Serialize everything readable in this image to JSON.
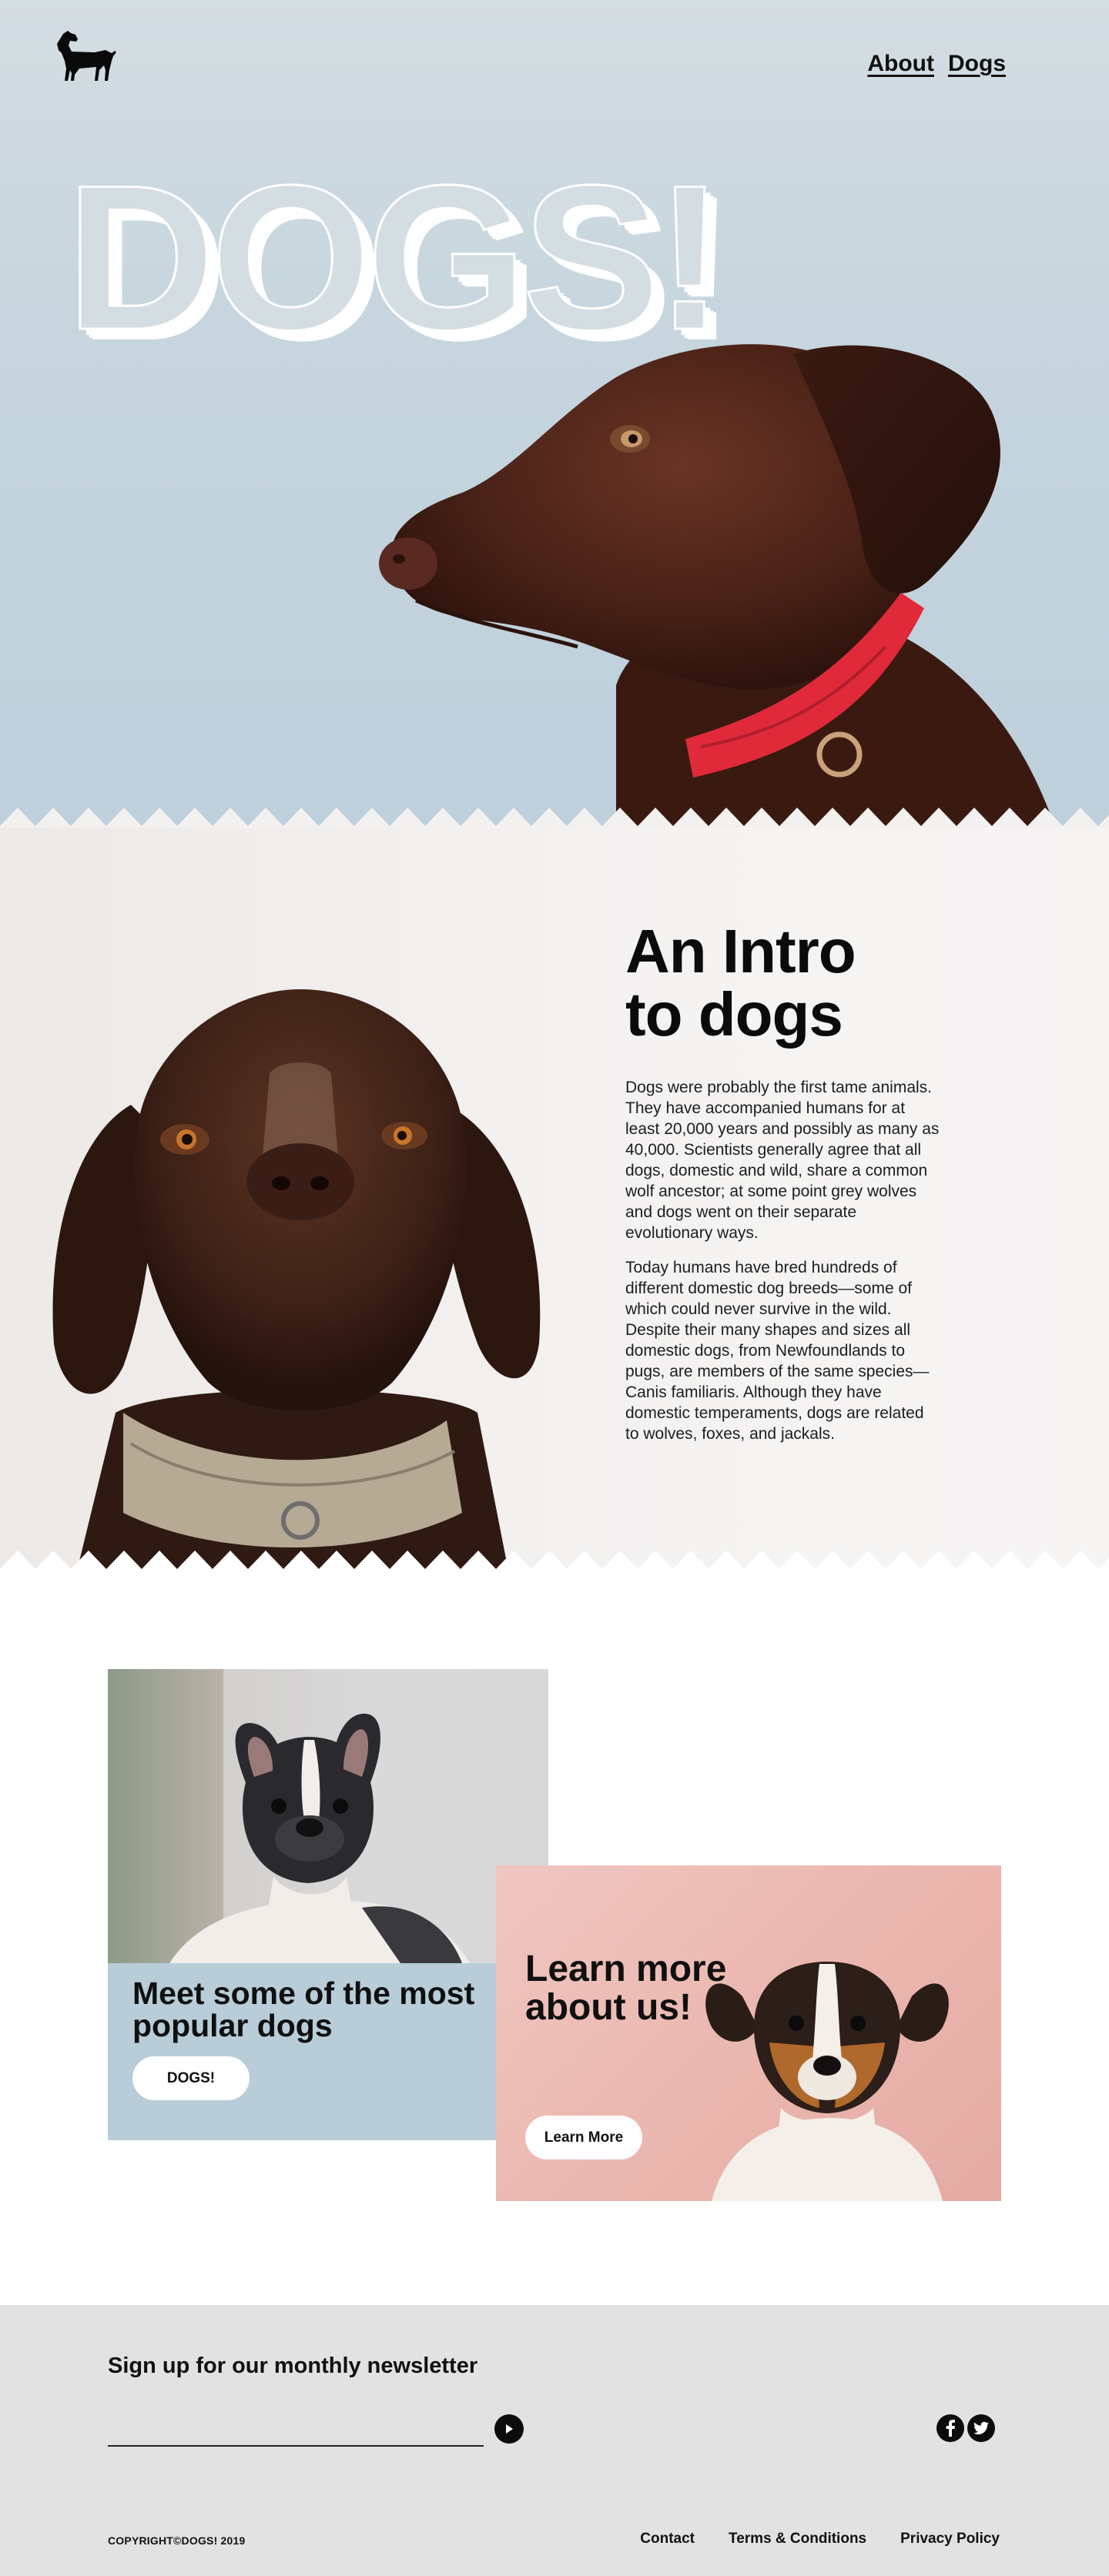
{
  "header": {
    "logo_icon": "dog-silhouette-icon",
    "nav": [
      {
        "label": "About"
      },
      {
        "label": "Dogs"
      }
    ]
  },
  "hero": {
    "title": "DOGS!",
    "image": "chocolate-labrador-photo"
  },
  "intro": {
    "heading_line1": "An Intro",
    "heading_line2": "to dogs",
    "paragraphs": [
      "Dogs were probably the first tame animals. They have accompanied humans for at least 20,000 years and possibly as many as 40,000. Scientists generally agree that all dogs, domestic and wild, share a common wolf ancestor; at some point grey wolves and dogs went on their separate evolutionary ways.",
      "Today humans have bred hundreds of different domestic dog breeds—some of which could never survive in the wild. Despite their many shapes and sizes all domestic dogs, from Newfoundlands to pugs, are members of the same species—Canis familiaris. Although they have domestic temperaments, dogs are related to wolves, foxes, and jackals."
    ],
    "image": "brown-pointer-dog-photo"
  },
  "cards": {
    "popular": {
      "title": "Meet some of the most popular dogs",
      "button_label": "DOGS!",
      "image": "french-bulldog-photo"
    },
    "about": {
      "title": "Learn more about us!",
      "button_label": "Learn More",
      "image": "jack-russell-terrier-photo"
    }
  },
  "footer": {
    "newsletter_title": "Sign up for our monthly newsletter",
    "email_placeholder": "",
    "submit_icon": "play-arrow-icon",
    "social": [
      {
        "icon": "facebook-icon"
      },
      {
        "icon": "twitter-icon"
      }
    ],
    "copyright": "COPYRIGHT©DOGS! 2019",
    "links": [
      {
        "label": "Contact"
      },
      {
        "label": "Terms & Conditions"
      },
      {
        "label": "Privacy Policy"
      }
    ]
  },
  "colors": {
    "hero_bg": "#c6d5de",
    "intro_bg": "#f3f1f0",
    "card_blue": "#b8cdd8",
    "card_pink": "#eab6ae",
    "footer_bg": "#e2e2e2",
    "dog_brown": "#4a2418",
    "collar_red": "#e02a3a"
  }
}
